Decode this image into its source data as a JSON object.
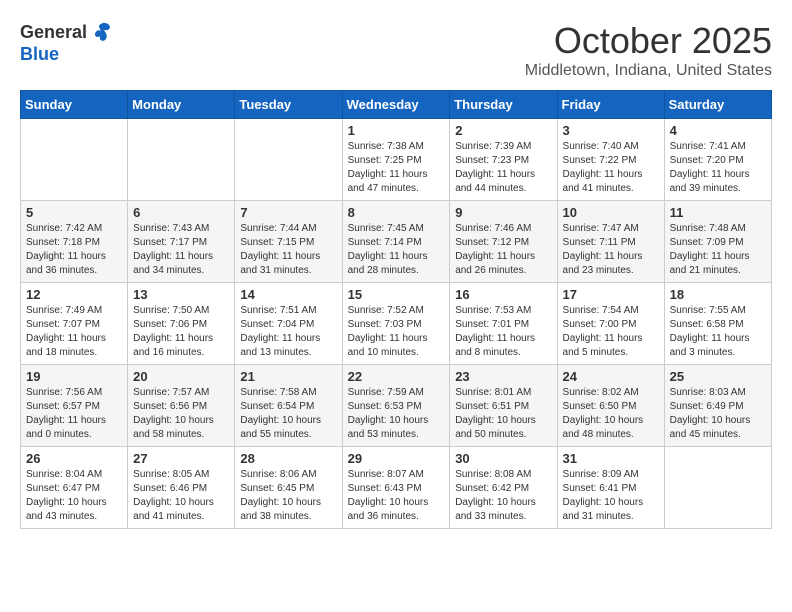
{
  "logo": {
    "general": "General",
    "blue": "Blue"
  },
  "title": "October 2025",
  "location": "Middletown, Indiana, United States",
  "weekdays": [
    "Sunday",
    "Monday",
    "Tuesday",
    "Wednesday",
    "Thursday",
    "Friday",
    "Saturday"
  ],
  "weeks": [
    [
      {
        "day": "",
        "info": ""
      },
      {
        "day": "",
        "info": ""
      },
      {
        "day": "",
        "info": ""
      },
      {
        "day": "1",
        "info": "Sunrise: 7:38 AM\nSunset: 7:25 PM\nDaylight: 11 hours\nand 47 minutes."
      },
      {
        "day": "2",
        "info": "Sunrise: 7:39 AM\nSunset: 7:23 PM\nDaylight: 11 hours\nand 44 minutes."
      },
      {
        "day": "3",
        "info": "Sunrise: 7:40 AM\nSunset: 7:22 PM\nDaylight: 11 hours\nand 41 minutes."
      },
      {
        "day": "4",
        "info": "Sunrise: 7:41 AM\nSunset: 7:20 PM\nDaylight: 11 hours\nand 39 minutes."
      }
    ],
    [
      {
        "day": "5",
        "info": "Sunrise: 7:42 AM\nSunset: 7:18 PM\nDaylight: 11 hours\nand 36 minutes."
      },
      {
        "day": "6",
        "info": "Sunrise: 7:43 AM\nSunset: 7:17 PM\nDaylight: 11 hours\nand 34 minutes."
      },
      {
        "day": "7",
        "info": "Sunrise: 7:44 AM\nSunset: 7:15 PM\nDaylight: 11 hours\nand 31 minutes."
      },
      {
        "day": "8",
        "info": "Sunrise: 7:45 AM\nSunset: 7:14 PM\nDaylight: 11 hours\nand 28 minutes."
      },
      {
        "day": "9",
        "info": "Sunrise: 7:46 AM\nSunset: 7:12 PM\nDaylight: 11 hours\nand 26 minutes."
      },
      {
        "day": "10",
        "info": "Sunrise: 7:47 AM\nSunset: 7:11 PM\nDaylight: 11 hours\nand 23 minutes."
      },
      {
        "day": "11",
        "info": "Sunrise: 7:48 AM\nSunset: 7:09 PM\nDaylight: 11 hours\nand 21 minutes."
      }
    ],
    [
      {
        "day": "12",
        "info": "Sunrise: 7:49 AM\nSunset: 7:07 PM\nDaylight: 11 hours\nand 18 minutes."
      },
      {
        "day": "13",
        "info": "Sunrise: 7:50 AM\nSunset: 7:06 PM\nDaylight: 11 hours\nand 16 minutes."
      },
      {
        "day": "14",
        "info": "Sunrise: 7:51 AM\nSunset: 7:04 PM\nDaylight: 11 hours\nand 13 minutes."
      },
      {
        "day": "15",
        "info": "Sunrise: 7:52 AM\nSunset: 7:03 PM\nDaylight: 11 hours\nand 10 minutes."
      },
      {
        "day": "16",
        "info": "Sunrise: 7:53 AM\nSunset: 7:01 PM\nDaylight: 11 hours\nand 8 minutes."
      },
      {
        "day": "17",
        "info": "Sunrise: 7:54 AM\nSunset: 7:00 PM\nDaylight: 11 hours\nand 5 minutes."
      },
      {
        "day": "18",
        "info": "Sunrise: 7:55 AM\nSunset: 6:58 PM\nDaylight: 11 hours\nand 3 minutes."
      }
    ],
    [
      {
        "day": "19",
        "info": "Sunrise: 7:56 AM\nSunset: 6:57 PM\nDaylight: 11 hours\nand 0 minutes."
      },
      {
        "day": "20",
        "info": "Sunrise: 7:57 AM\nSunset: 6:56 PM\nDaylight: 10 hours\nand 58 minutes."
      },
      {
        "day": "21",
        "info": "Sunrise: 7:58 AM\nSunset: 6:54 PM\nDaylight: 10 hours\nand 55 minutes."
      },
      {
        "day": "22",
        "info": "Sunrise: 7:59 AM\nSunset: 6:53 PM\nDaylight: 10 hours\nand 53 minutes."
      },
      {
        "day": "23",
        "info": "Sunrise: 8:01 AM\nSunset: 6:51 PM\nDaylight: 10 hours\nand 50 minutes."
      },
      {
        "day": "24",
        "info": "Sunrise: 8:02 AM\nSunset: 6:50 PM\nDaylight: 10 hours\nand 48 minutes."
      },
      {
        "day": "25",
        "info": "Sunrise: 8:03 AM\nSunset: 6:49 PM\nDaylight: 10 hours\nand 45 minutes."
      }
    ],
    [
      {
        "day": "26",
        "info": "Sunrise: 8:04 AM\nSunset: 6:47 PM\nDaylight: 10 hours\nand 43 minutes."
      },
      {
        "day": "27",
        "info": "Sunrise: 8:05 AM\nSunset: 6:46 PM\nDaylight: 10 hours\nand 41 minutes."
      },
      {
        "day": "28",
        "info": "Sunrise: 8:06 AM\nSunset: 6:45 PM\nDaylight: 10 hours\nand 38 minutes."
      },
      {
        "day": "29",
        "info": "Sunrise: 8:07 AM\nSunset: 6:43 PM\nDaylight: 10 hours\nand 36 minutes."
      },
      {
        "day": "30",
        "info": "Sunrise: 8:08 AM\nSunset: 6:42 PM\nDaylight: 10 hours\nand 33 minutes."
      },
      {
        "day": "31",
        "info": "Sunrise: 8:09 AM\nSunset: 6:41 PM\nDaylight: 10 hours\nand 31 minutes."
      },
      {
        "day": "",
        "info": ""
      }
    ]
  ]
}
